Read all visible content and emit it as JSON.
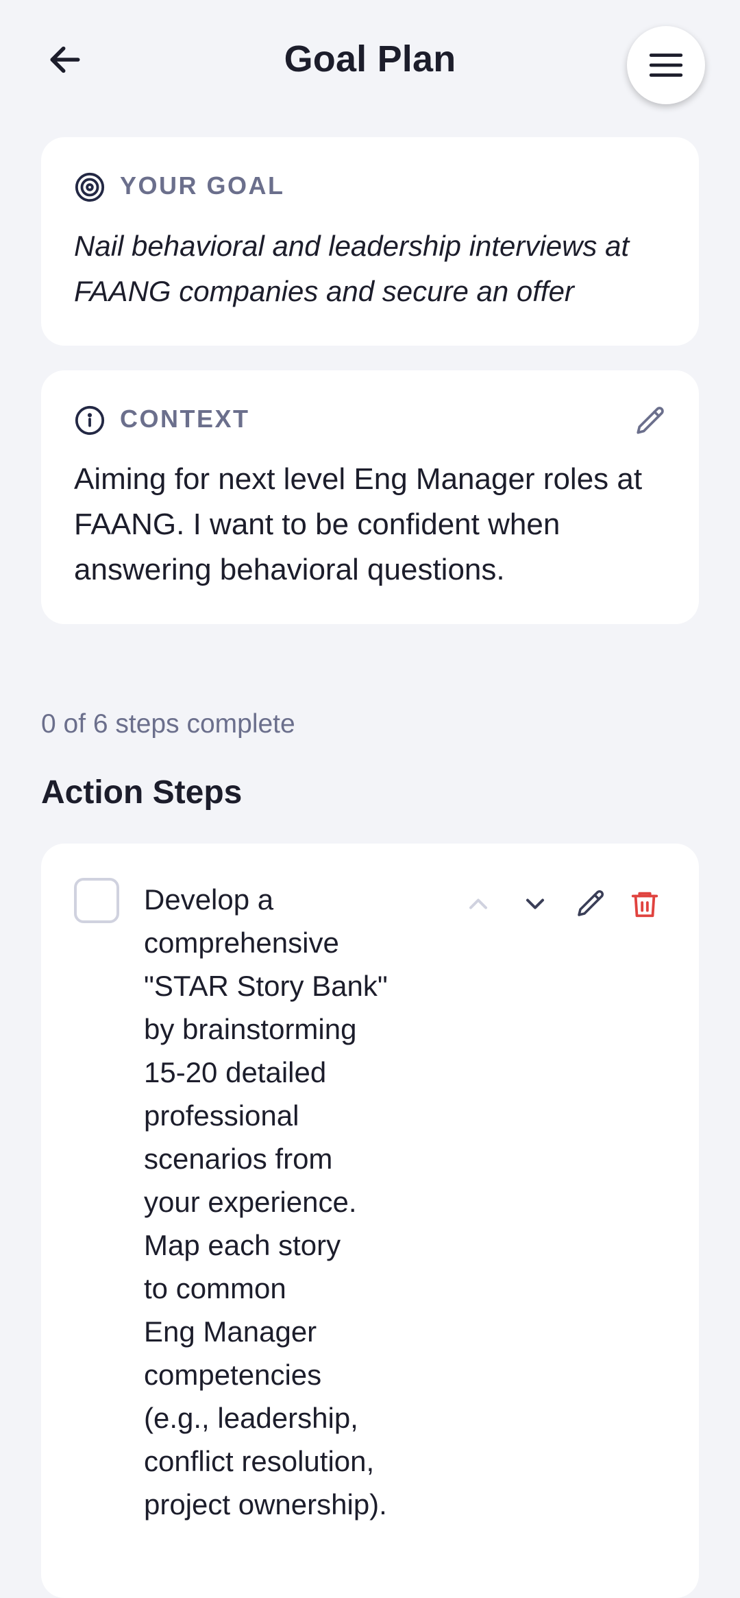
{
  "header": {
    "title": "Goal Plan"
  },
  "goal": {
    "label": "YOUR GOAL",
    "text": "Nail behavioral and leadership interviews at FAANG companies and secure an offer"
  },
  "context": {
    "label": "CONTEXT",
    "text": "Aiming for next level Eng Manager roles at FAANG. I want to be confident when answering behavioral questions."
  },
  "progress": {
    "text": "0 of 6 steps complete",
    "completed": 0,
    "total": 6
  },
  "steps_section": {
    "title": "Action Steps"
  },
  "steps": [
    {
      "text": "Develop a\ncomprehensive\n\"STAR Story Bank\"\nby brainstorming\n15-20 detailed\nprofessional\nscenarios from\nyour experience.\nMap each story\nto common\nEng Manager\ncompetencies\n(e.g., leadership,\nconflict resolution,\nproject ownership).",
      "checked": false
    }
  ],
  "colors": {
    "background": "#f3f4f8",
    "label": "#6b6f8c",
    "delete": "#e0433f",
    "disabled_icon": "#d0d2df"
  },
  "icons": [
    "back-arrow-icon",
    "hamburger-menu-icon",
    "target-icon",
    "info-icon",
    "pencil-icon",
    "chevron-up-icon",
    "chevron-down-icon",
    "trash-icon"
  ]
}
